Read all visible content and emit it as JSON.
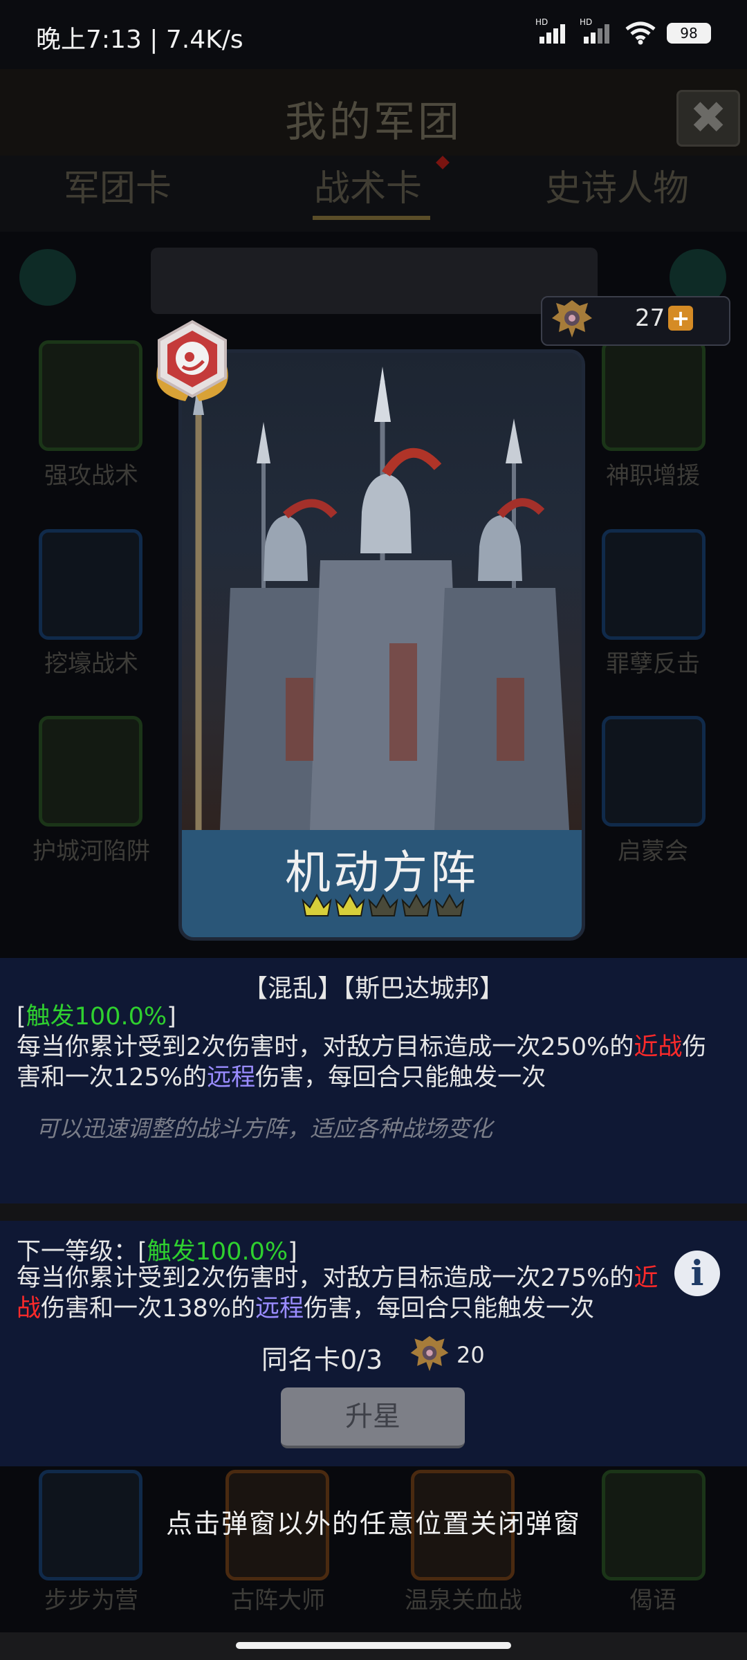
{
  "status_bar": {
    "time": "晚上7:13 | 7.4K/s",
    "battery": "98",
    "hd1": "HD",
    "hd2": "HD"
  },
  "background": {
    "title": "我的军团",
    "close_symbol": "✖",
    "tabs": [
      "军团卡",
      "战术卡",
      "史诗人物"
    ],
    "grid_labels": [
      "强攻战术",
      "神职增援",
      "挖壕战术",
      "罪孽反击",
      "护城河陷阱",
      "启蒙会",
      "步步为营",
      "古阵大师",
      "温泉关血战",
      "偈语"
    ]
  },
  "currency": {
    "value": "27",
    "plus": "+"
  },
  "card": {
    "name": "机动方阵",
    "stars_total": 5,
    "stars_filled": 2
  },
  "detail": {
    "tags": "【混乱】【斯巴达城邦】",
    "trigger_open": "[",
    "trigger": "触发100.0%",
    "trigger_close": "]",
    "desc_a": "每当你累计受到2次伤害时，对敌方目标造成一次250%的",
    "desc_red": "近战",
    "desc_b": "伤害和一次125%的",
    "desc_purple": "远程",
    "desc_c": "伤害，每回合只能触发一次",
    "flavor": "可以迅速调整的战斗方阵，适应各种战场变化"
  },
  "next_level": {
    "label": "下一等级：[",
    "trigger": "触发100.0%",
    "trigger_close": "]",
    "desc_a": "每当你累计受到2次伤害时，对敌方目标造成一次275%的",
    "desc_red": "近战",
    "desc_b": "伤害和一次138%的",
    "desc_purple": "远程",
    "desc_c": "伤害，每回合只能触发一次"
  },
  "duplicates": {
    "label": "同名卡0/3",
    "cost": "20"
  },
  "upgrade_button": "升星",
  "info_symbol": "i",
  "hint": "点击弹窗以外的任意位置关闭弹窗",
  "colors": {
    "trigger_green": "#2fd02f",
    "melee_red": "#ff2a2a",
    "ranged_purple": "#9a8cff",
    "panel_bg": "#0f1834"
  }
}
